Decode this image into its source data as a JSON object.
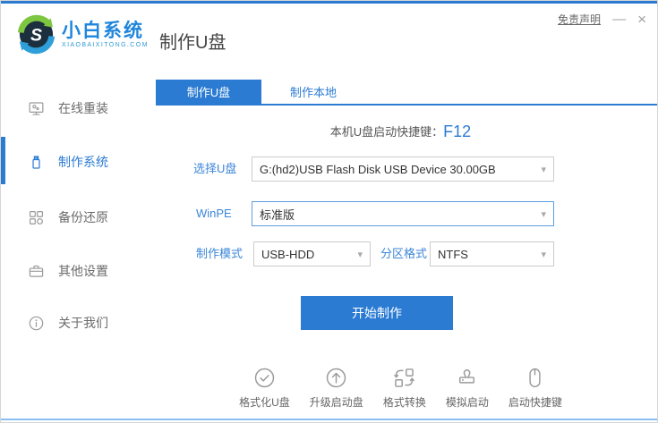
{
  "window": {
    "disclaimer": "免责声明",
    "minimize": "—",
    "close": "×"
  },
  "header": {
    "logo_title": "小白系统",
    "logo_subtitle": "XIAOBAIXITONG.COM",
    "page_title": "制作U盘"
  },
  "colors": {
    "accent": "#2b7bd3",
    "label_blue": "#3c86d8",
    "bottom_line": "#8abdf0",
    "icon_gray": "#9a9a9a"
  },
  "sidebar": {
    "items": [
      {
        "label": "在线重装",
        "icon": "online-reinstall-icon",
        "active": false
      },
      {
        "label": "制作系统",
        "icon": "usb-make-icon",
        "active": true
      },
      {
        "label": "备份还原",
        "icon": "backup-restore-icon",
        "active": false
      },
      {
        "label": "其他设置",
        "icon": "other-settings-icon",
        "active": false
      },
      {
        "label": "关于我们",
        "icon": "about-us-icon",
        "active": false
      }
    ]
  },
  "tabs": [
    {
      "label": "制作U盘",
      "active": true
    },
    {
      "label": "制作本地",
      "active": false
    }
  ],
  "main": {
    "hotkey_label": "本机U盘启动快捷键：",
    "hotkey_value": "F12",
    "fields": {
      "usb": {
        "label": "选择U盘",
        "value": "G:(hd2)USB Flash Disk USB Device 30.00GB"
      },
      "winpe": {
        "label": "WinPE",
        "value": "标准版"
      },
      "mode": {
        "label": "制作模式",
        "value": "USB-HDD"
      },
      "partition": {
        "label": "分区格式",
        "value": "NTFS"
      }
    },
    "start_button": "开始制作",
    "tools": [
      {
        "label": "格式化U盘",
        "icon": "format-usb-icon"
      },
      {
        "label": "升级启动盘",
        "icon": "upgrade-boot-disk-icon"
      },
      {
        "label": "格式转换",
        "icon": "format-convert-icon"
      },
      {
        "label": "模拟启动",
        "icon": "simulate-boot-icon"
      },
      {
        "label": "启动快捷键",
        "icon": "boot-hotkey-icon"
      }
    ]
  }
}
